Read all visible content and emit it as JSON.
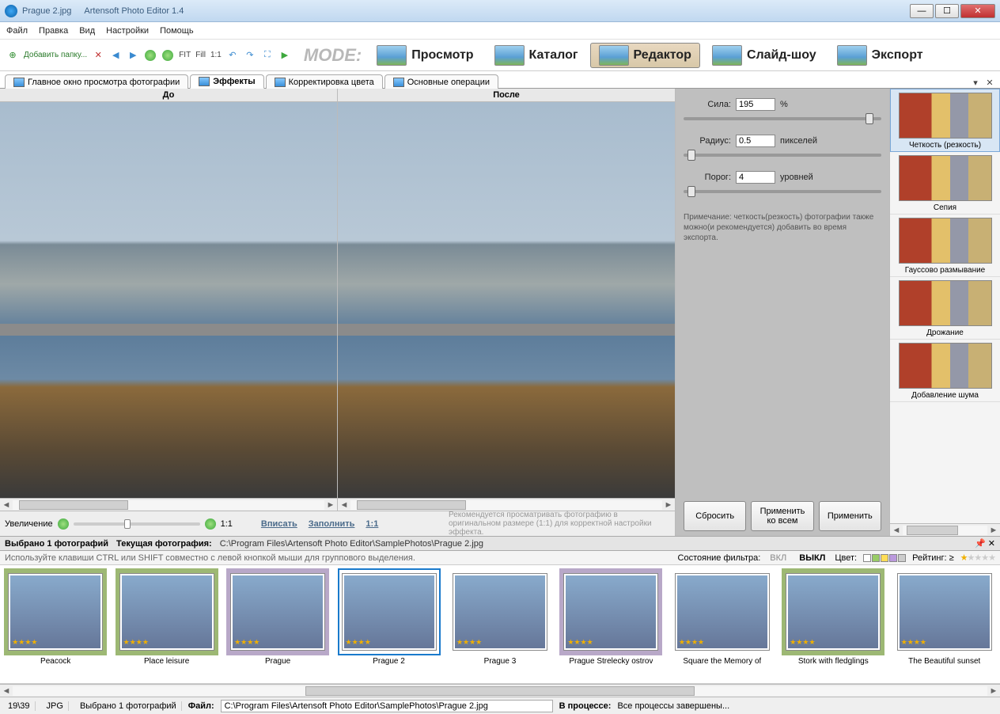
{
  "title": {
    "file": "Prague 2.jpg",
    "app": "Artensoft Photo Editor 1.4"
  },
  "menu": [
    "Файл",
    "Правка",
    "Вид",
    "Настройки",
    "Помощь"
  ],
  "toolbar": {
    "add_folder": "Добавить папку...",
    "fit": "FIT",
    "fill": "Fill",
    "oneone": "1:1",
    "mode_label": "MODE:"
  },
  "modes": [
    {
      "label": "Просмотр"
    },
    {
      "label": "Каталог"
    },
    {
      "label": "Редактор",
      "active": true
    },
    {
      "label": "Слайд-шоу"
    },
    {
      "label": "Экспорт"
    }
  ],
  "tabs": [
    {
      "label": "Главное окно просмотра фотографии"
    },
    {
      "label": "Эффекты",
      "active": true
    },
    {
      "label": "Корректировка цвета"
    },
    {
      "label": "Основные операции"
    }
  ],
  "preview": {
    "before": "До",
    "after": "После",
    "zoom_label": "Увеличение",
    "oneone": "1:1",
    "fit": "Вписать",
    "fill": "Заполнить",
    "oneone2": "1:1",
    "note": "Рекомендуется просматривать фотографию в оригинальном размере (1:1) для корректной настройки эффекта."
  },
  "controls": {
    "strength_label": "Сила:",
    "strength_value": "195",
    "strength_unit": "%",
    "radius_label": "Радиус:",
    "radius_value": "0.5",
    "radius_unit": "пикселей",
    "threshold_label": "Порог:",
    "threshold_value": "4",
    "threshold_unit": "уровней",
    "note": "Примечание: четкость(резкость) фотографии также можно(и рекомендуется) добавить во время экспорта.",
    "reset": "Сбросить",
    "apply_all": "Применить ко всем",
    "apply": "Применить"
  },
  "effects": [
    "Четкость (резкость)",
    "Сепия",
    "Гауссово размывание",
    "Дрожание",
    "Добавление шума"
  ],
  "strip": {
    "selected_count": "Выбрано 1  фотографий",
    "current_label": "Текущая фотография:",
    "path": "C:\\Program Files\\Artensoft Photo Editor\\SamplePhotos\\Prague 2.jpg",
    "hint": "Используйте клавиши CTRL или SHIFT совместно с левой кнопкой мыши для группового выделения.",
    "filter_state": "Состояние фильтра:",
    "on": "ВКЛ",
    "off": "ВЫКЛ",
    "color": "Цвет:",
    "rating": "Рейтинг:  ≥"
  },
  "thumbs": [
    {
      "cap": "Peacock",
      "cls": "green"
    },
    {
      "cap": "Place leisure",
      "cls": "green"
    },
    {
      "cap": "Prague",
      "cls": "violet"
    },
    {
      "cap": "Prague 2",
      "cls": "",
      "sel": true
    },
    {
      "cap": "Prague 3",
      "cls": ""
    },
    {
      "cap": "Prague Strelecky ostrov",
      "cls": "violet"
    },
    {
      "cap": "Square the Memory of",
      "cls": ""
    },
    {
      "cap": "Stork with fledglings",
      "cls": "green"
    },
    {
      "cap": "The Beautiful sunset",
      "cls": ""
    }
  ],
  "status": {
    "count": "19\\39",
    "fmt": "JPG",
    "sel": "Выбрано 1 фотографий",
    "file_label": "Файл:",
    "file_path": "C:\\Program Files\\Artensoft Photo Editor\\SamplePhotos\\Prague 2.jpg",
    "proc_label": "В процессе:",
    "proc_msg": "Все процессы завершены..."
  }
}
